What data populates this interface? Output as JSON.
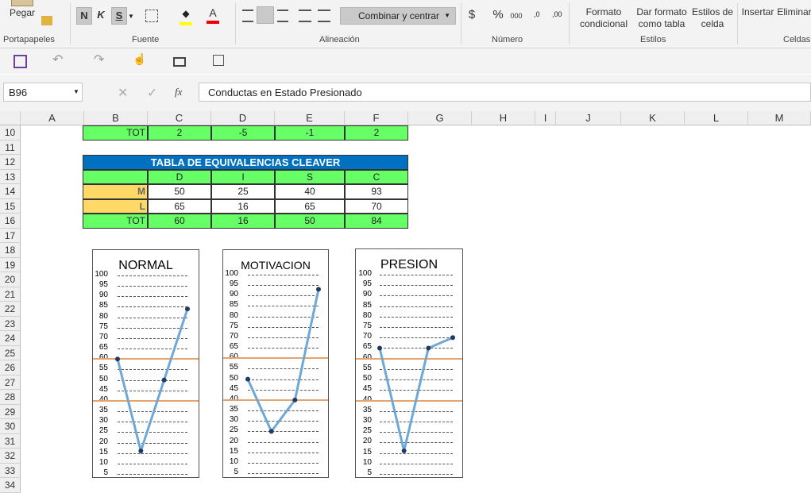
{
  "ribbon": {
    "paste_label": "Pegar",
    "font_group": "Fuente",
    "clipboard_group": "Portapapeles",
    "align_group": "Alineación",
    "number_group": "Número",
    "styles_group": "Estilos",
    "cells_group": "Celdas",
    "bold": "N",
    "italic": "K",
    "underline": "S",
    "combine": "Combinar y centrar",
    "currency": "$",
    "percent": "%",
    "thousands": "000",
    "cond_format_1": "Formato",
    "cond_format_2": "condicional",
    "table_format_1": "Dar formato",
    "table_format_2": "como tabla",
    "cell_styles_1": "Estilos de",
    "cell_styles_2": "celda",
    "insert": "Insertar",
    "delete": "Eliminar"
  },
  "formula_bar": {
    "name_box": "B96",
    "formula": "Conductas en Estado Presionado",
    "fx": "fx"
  },
  "columns": [
    "A",
    "B",
    "C",
    "D",
    "E",
    "F",
    "G",
    "H",
    "I",
    "J",
    "K",
    "L",
    "M"
  ],
  "rows": [
    "10",
    "11",
    "12",
    "13",
    "14",
    "15",
    "16",
    "17",
    "18",
    "19",
    "20",
    "21",
    "22",
    "23",
    "24",
    "25",
    "26",
    "27",
    "28",
    "29",
    "30",
    "31",
    "32",
    "33",
    "34"
  ],
  "row10": {
    "label": "TOT",
    "values": [
      "2",
      "-5",
      "-1",
      "2"
    ]
  },
  "cleaver": {
    "title": "TABLA DE EQUIVALENCIAS CLEAVER",
    "headers": [
      "D",
      "I",
      "S",
      "C"
    ],
    "rows": [
      {
        "label": "M",
        "values": [
          "50",
          "25",
          "40",
          "93"
        ]
      },
      {
        "label": "L",
        "values": [
          "65",
          "16",
          "65",
          "70"
        ]
      },
      {
        "label": "TOT",
        "values": [
          "60",
          "16",
          "50",
          "84"
        ]
      }
    ]
  },
  "charts": [
    {
      "title": "NORMAL",
      "values": [
        60,
        16,
        50,
        84
      ]
    },
    {
      "title": "MOTIVACION",
      "values": [
        50,
        25,
        40,
        93
      ]
    },
    {
      "title": "PRESION",
      "values": [
        65,
        16,
        65,
        70
      ]
    }
  ],
  "y_ticks": [
    "100",
    "95",
    "90",
    "85",
    "80",
    "75",
    "70",
    "65",
    "60",
    "55",
    "50",
    "45",
    "40",
    "35",
    "30",
    "25",
    "20",
    "15",
    "10",
    "5"
  ],
  "colors": {
    "green": "#66ff66",
    "blue_header": "#0070c0",
    "yellow": "#ffd966",
    "line": "#6fa8d6",
    "threshold": "#e5a36f"
  }
}
